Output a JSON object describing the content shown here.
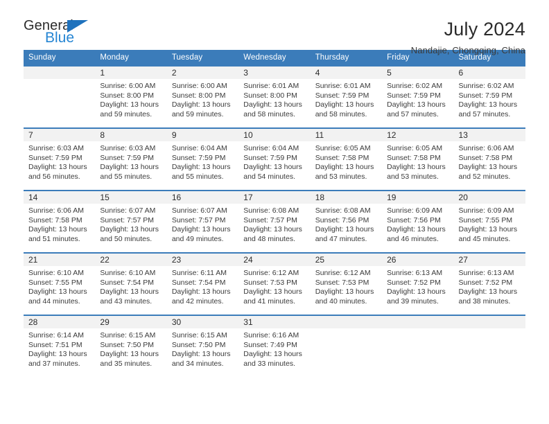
{
  "brand": {
    "name_part1": "General",
    "name_part2": "Blue",
    "accent_color": "#2585d3",
    "triangle_color": "#1f72bd"
  },
  "header": {
    "title": "July 2024",
    "subtitle": "Nandajie, Chongqing, China"
  },
  "calendar": {
    "header_bg": "#3b7cba",
    "daynum_bg": "#f2f2f2",
    "weekday_labels": [
      "Sunday",
      "Monday",
      "Tuesday",
      "Wednesday",
      "Thursday",
      "Friday",
      "Saturday"
    ],
    "weeks": [
      [
        {
          "day": "",
          "sunrise": "",
          "sunset": "",
          "daylight_line1": "",
          "daylight_line2": ""
        },
        {
          "day": "1",
          "sunrise": "Sunrise: 6:00 AM",
          "sunset": "Sunset: 8:00 PM",
          "daylight_line1": "Daylight: 13 hours",
          "daylight_line2": "and 59 minutes."
        },
        {
          "day": "2",
          "sunrise": "Sunrise: 6:00 AM",
          "sunset": "Sunset: 8:00 PM",
          "daylight_line1": "Daylight: 13 hours",
          "daylight_line2": "and 59 minutes."
        },
        {
          "day": "3",
          "sunrise": "Sunrise: 6:01 AM",
          "sunset": "Sunset: 8:00 PM",
          "daylight_line1": "Daylight: 13 hours",
          "daylight_line2": "and 58 minutes."
        },
        {
          "day": "4",
          "sunrise": "Sunrise: 6:01 AM",
          "sunset": "Sunset: 7:59 PM",
          "daylight_line1": "Daylight: 13 hours",
          "daylight_line2": "and 58 minutes."
        },
        {
          "day": "5",
          "sunrise": "Sunrise: 6:02 AM",
          "sunset": "Sunset: 7:59 PM",
          "daylight_line1": "Daylight: 13 hours",
          "daylight_line2": "and 57 minutes."
        },
        {
          "day": "6",
          "sunrise": "Sunrise: 6:02 AM",
          "sunset": "Sunset: 7:59 PM",
          "daylight_line1": "Daylight: 13 hours",
          "daylight_line2": "and 57 minutes."
        }
      ],
      [
        {
          "day": "7",
          "sunrise": "Sunrise: 6:03 AM",
          "sunset": "Sunset: 7:59 PM",
          "daylight_line1": "Daylight: 13 hours",
          "daylight_line2": "and 56 minutes."
        },
        {
          "day": "8",
          "sunrise": "Sunrise: 6:03 AM",
          "sunset": "Sunset: 7:59 PM",
          "daylight_line1": "Daylight: 13 hours",
          "daylight_line2": "and 55 minutes."
        },
        {
          "day": "9",
          "sunrise": "Sunrise: 6:04 AM",
          "sunset": "Sunset: 7:59 PM",
          "daylight_line1": "Daylight: 13 hours",
          "daylight_line2": "and 55 minutes."
        },
        {
          "day": "10",
          "sunrise": "Sunrise: 6:04 AM",
          "sunset": "Sunset: 7:59 PM",
          "daylight_line1": "Daylight: 13 hours",
          "daylight_line2": "and 54 minutes."
        },
        {
          "day": "11",
          "sunrise": "Sunrise: 6:05 AM",
          "sunset": "Sunset: 7:58 PM",
          "daylight_line1": "Daylight: 13 hours",
          "daylight_line2": "and 53 minutes."
        },
        {
          "day": "12",
          "sunrise": "Sunrise: 6:05 AM",
          "sunset": "Sunset: 7:58 PM",
          "daylight_line1": "Daylight: 13 hours",
          "daylight_line2": "and 53 minutes."
        },
        {
          "day": "13",
          "sunrise": "Sunrise: 6:06 AM",
          "sunset": "Sunset: 7:58 PM",
          "daylight_line1": "Daylight: 13 hours",
          "daylight_line2": "and 52 minutes."
        }
      ],
      [
        {
          "day": "14",
          "sunrise": "Sunrise: 6:06 AM",
          "sunset": "Sunset: 7:58 PM",
          "daylight_line1": "Daylight: 13 hours",
          "daylight_line2": "and 51 minutes."
        },
        {
          "day": "15",
          "sunrise": "Sunrise: 6:07 AM",
          "sunset": "Sunset: 7:57 PM",
          "daylight_line1": "Daylight: 13 hours",
          "daylight_line2": "and 50 minutes."
        },
        {
          "day": "16",
          "sunrise": "Sunrise: 6:07 AM",
          "sunset": "Sunset: 7:57 PM",
          "daylight_line1": "Daylight: 13 hours",
          "daylight_line2": "and 49 minutes."
        },
        {
          "day": "17",
          "sunrise": "Sunrise: 6:08 AM",
          "sunset": "Sunset: 7:57 PM",
          "daylight_line1": "Daylight: 13 hours",
          "daylight_line2": "and 48 minutes."
        },
        {
          "day": "18",
          "sunrise": "Sunrise: 6:08 AM",
          "sunset": "Sunset: 7:56 PM",
          "daylight_line1": "Daylight: 13 hours",
          "daylight_line2": "and 47 minutes."
        },
        {
          "day": "19",
          "sunrise": "Sunrise: 6:09 AM",
          "sunset": "Sunset: 7:56 PM",
          "daylight_line1": "Daylight: 13 hours",
          "daylight_line2": "and 46 minutes."
        },
        {
          "day": "20",
          "sunrise": "Sunrise: 6:09 AM",
          "sunset": "Sunset: 7:55 PM",
          "daylight_line1": "Daylight: 13 hours",
          "daylight_line2": "and 45 minutes."
        }
      ],
      [
        {
          "day": "21",
          "sunrise": "Sunrise: 6:10 AM",
          "sunset": "Sunset: 7:55 PM",
          "daylight_line1": "Daylight: 13 hours",
          "daylight_line2": "and 44 minutes."
        },
        {
          "day": "22",
          "sunrise": "Sunrise: 6:10 AM",
          "sunset": "Sunset: 7:54 PM",
          "daylight_line1": "Daylight: 13 hours",
          "daylight_line2": "and 43 minutes."
        },
        {
          "day": "23",
          "sunrise": "Sunrise: 6:11 AM",
          "sunset": "Sunset: 7:54 PM",
          "daylight_line1": "Daylight: 13 hours",
          "daylight_line2": "and 42 minutes."
        },
        {
          "day": "24",
          "sunrise": "Sunrise: 6:12 AM",
          "sunset": "Sunset: 7:53 PM",
          "daylight_line1": "Daylight: 13 hours",
          "daylight_line2": "and 41 minutes."
        },
        {
          "day": "25",
          "sunrise": "Sunrise: 6:12 AM",
          "sunset": "Sunset: 7:53 PM",
          "daylight_line1": "Daylight: 13 hours",
          "daylight_line2": "and 40 minutes."
        },
        {
          "day": "26",
          "sunrise": "Sunrise: 6:13 AM",
          "sunset": "Sunset: 7:52 PM",
          "daylight_line1": "Daylight: 13 hours",
          "daylight_line2": "and 39 minutes."
        },
        {
          "day": "27",
          "sunrise": "Sunrise: 6:13 AM",
          "sunset": "Sunset: 7:52 PM",
          "daylight_line1": "Daylight: 13 hours",
          "daylight_line2": "and 38 minutes."
        }
      ],
      [
        {
          "day": "28",
          "sunrise": "Sunrise: 6:14 AM",
          "sunset": "Sunset: 7:51 PM",
          "daylight_line1": "Daylight: 13 hours",
          "daylight_line2": "and 37 minutes."
        },
        {
          "day": "29",
          "sunrise": "Sunrise: 6:15 AM",
          "sunset": "Sunset: 7:50 PM",
          "daylight_line1": "Daylight: 13 hours",
          "daylight_line2": "and 35 minutes."
        },
        {
          "day": "30",
          "sunrise": "Sunrise: 6:15 AM",
          "sunset": "Sunset: 7:50 PM",
          "daylight_line1": "Daylight: 13 hours",
          "daylight_line2": "and 34 minutes."
        },
        {
          "day": "31",
          "sunrise": "Sunrise: 6:16 AM",
          "sunset": "Sunset: 7:49 PM",
          "daylight_line1": "Daylight: 13 hours",
          "daylight_line2": "and 33 minutes."
        },
        {
          "day": "",
          "sunrise": "",
          "sunset": "",
          "daylight_line1": "",
          "daylight_line2": ""
        },
        {
          "day": "",
          "sunrise": "",
          "sunset": "",
          "daylight_line1": "",
          "daylight_line2": ""
        },
        {
          "day": "",
          "sunrise": "",
          "sunset": "",
          "daylight_line1": "",
          "daylight_line2": ""
        }
      ]
    ]
  }
}
